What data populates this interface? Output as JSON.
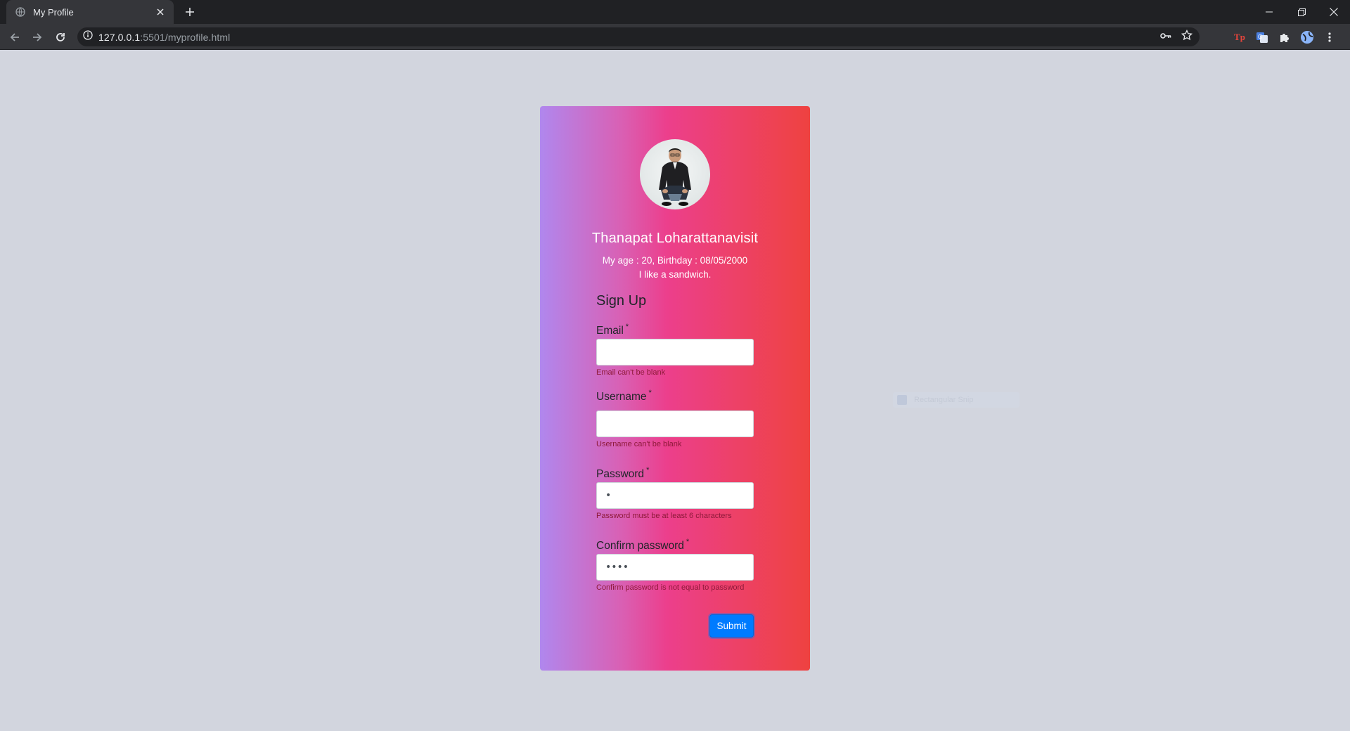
{
  "browser": {
    "tab_title": "My Profile",
    "url_host": "127.0.0.1",
    "url_rest": ":5501/myprofile.html",
    "extensions": [
      {
        "name": "tp-extension",
        "label": "Tp",
        "color": "#e8453c"
      },
      {
        "name": "translate-extension",
        "color": "#4a7fe0"
      },
      {
        "name": "puzzle-icon"
      },
      {
        "name": "profile-avatar-icon"
      }
    ]
  },
  "profile": {
    "name": "Thanapat Loharattanavisit",
    "age_birthday": "My age : 20, Birthday : 08/05/2000",
    "bio": "I like a sandwich."
  },
  "form": {
    "title": "Sign Up",
    "required_mark": "*",
    "fields": [
      {
        "label": "Email",
        "value": "",
        "error": "Email can't be blank"
      },
      {
        "label": "Username",
        "value": "",
        "error": "Username can't be blank"
      },
      {
        "label": "Password",
        "value": "•",
        "error": "Password must be at least 6 characters"
      },
      {
        "label": "Confirm password",
        "value": "••••",
        "error": "Confirm password is not equal to password"
      }
    ],
    "submit_label": "Submit"
  },
  "overlay": {
    "snip_label": "Rectangular Snip"
  },
  "colors": {
    "gradient_left": "#b087ee",
    "gradient_mid": "#ec3f8c",
    "gradient_right": "#ee4240",
    "submit": "#007bff",
    "error_text": "#8e1a3a",
    "page_bg": "#d2d5de"
  }
}
